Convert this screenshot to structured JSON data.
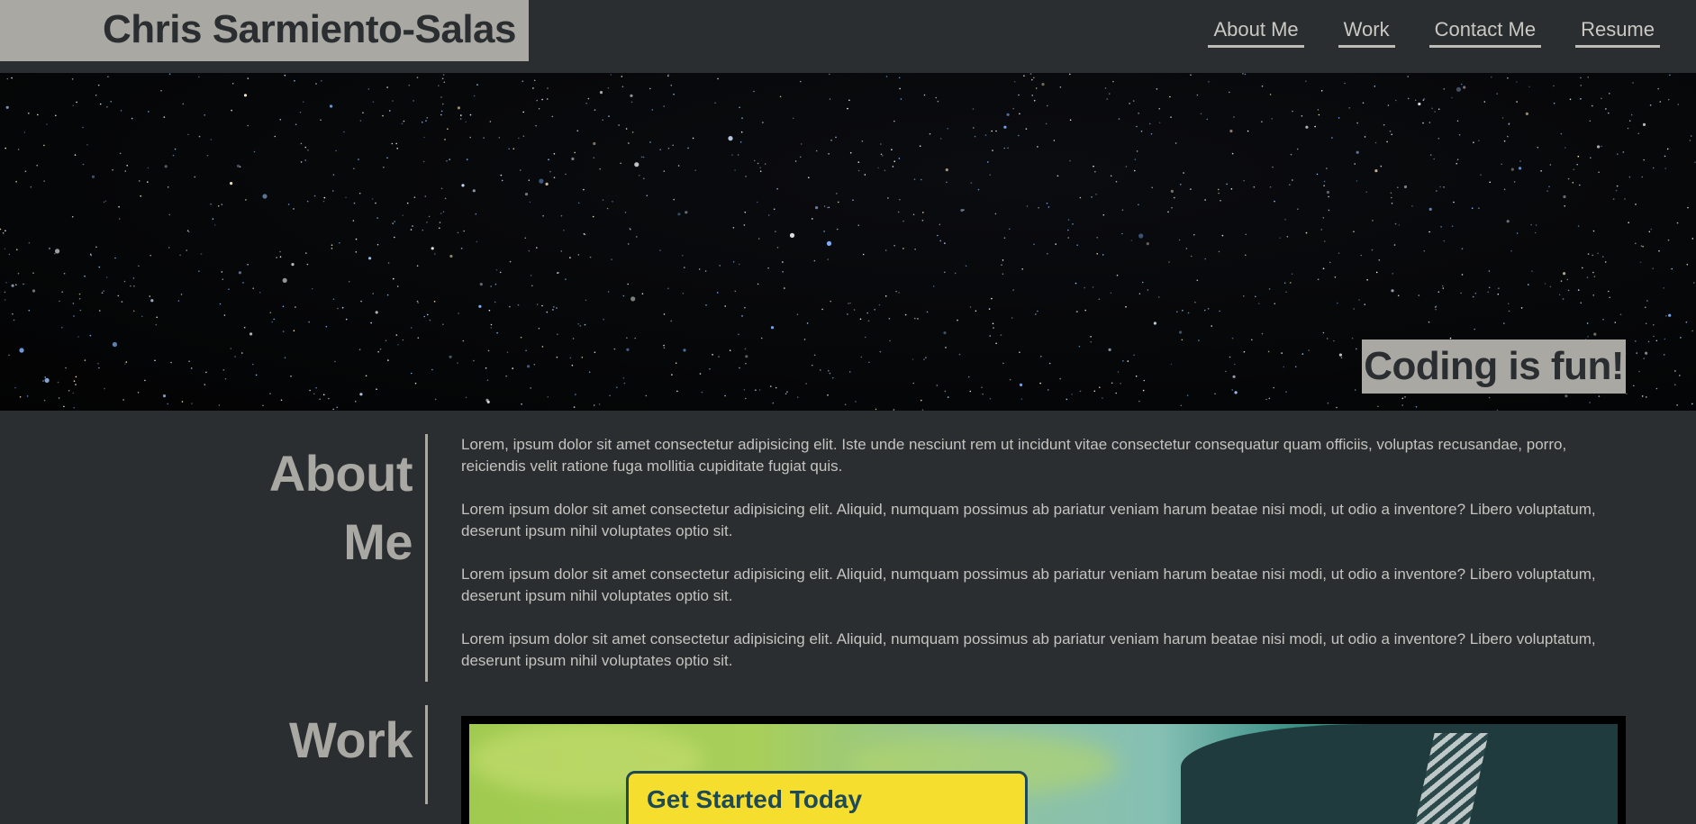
{
  "header": {
    "brand": "Chris Sarmiento-Salas",
    "nav": [
      "About Me",
      "Work",
      "Contact Me",
      "Resume"
    ]
  },
  "hero": {
    "tagline": "Coding is fun!"
  },
  "about": {
    "title_line1": "About",
    "title_line2": "Me",
    "paragraphs": [
      "Lorem, ipsum dolor sit amet consectetur adipisicing elit. Iste unde nesciunt rem ut incidunt vitae consectetur consequatur quam officiis, voluptas recusandae, porro, reiciendis velit ratione fuga mollitia cupiditate fugiat quis.",
      "Lorem ipsum dolor sit amet consectetur adipisicing elit. Aliquid, numquam possimus ab pariatur veniam harum beatae nisi modi, ut odio a inventore? Libero voluptatum, deserunt ipsum nihil voluptates optio sit.",
      "Lorem ipsum dolor sit amet consectetur adipisicing elit. Aliquid, numquam possimus ab pariatur veniam harum beatae nisi modi, ut odio a inventore? Libero voluptatum, deserunt ipsum nihil voluptates optio sit.",
      "Lorem ipsum dolor sit amet consectetur adipisicing elit. Aliquid, numquam possimus ab pariatur veniam harum beatae nisi modi, ut odio a inventore? Libero voluptatum, deserunt ipsum nihil voluptates optio sit."
    ]
  },
  "work": {
    "title": "Work",
    "project_cta": "Get Started Today"
  },
  "colors": {
    "background": "#2a2e31",
    "accent": "#a9a8a3",
    "text": "#c4c3be"
  }
}
